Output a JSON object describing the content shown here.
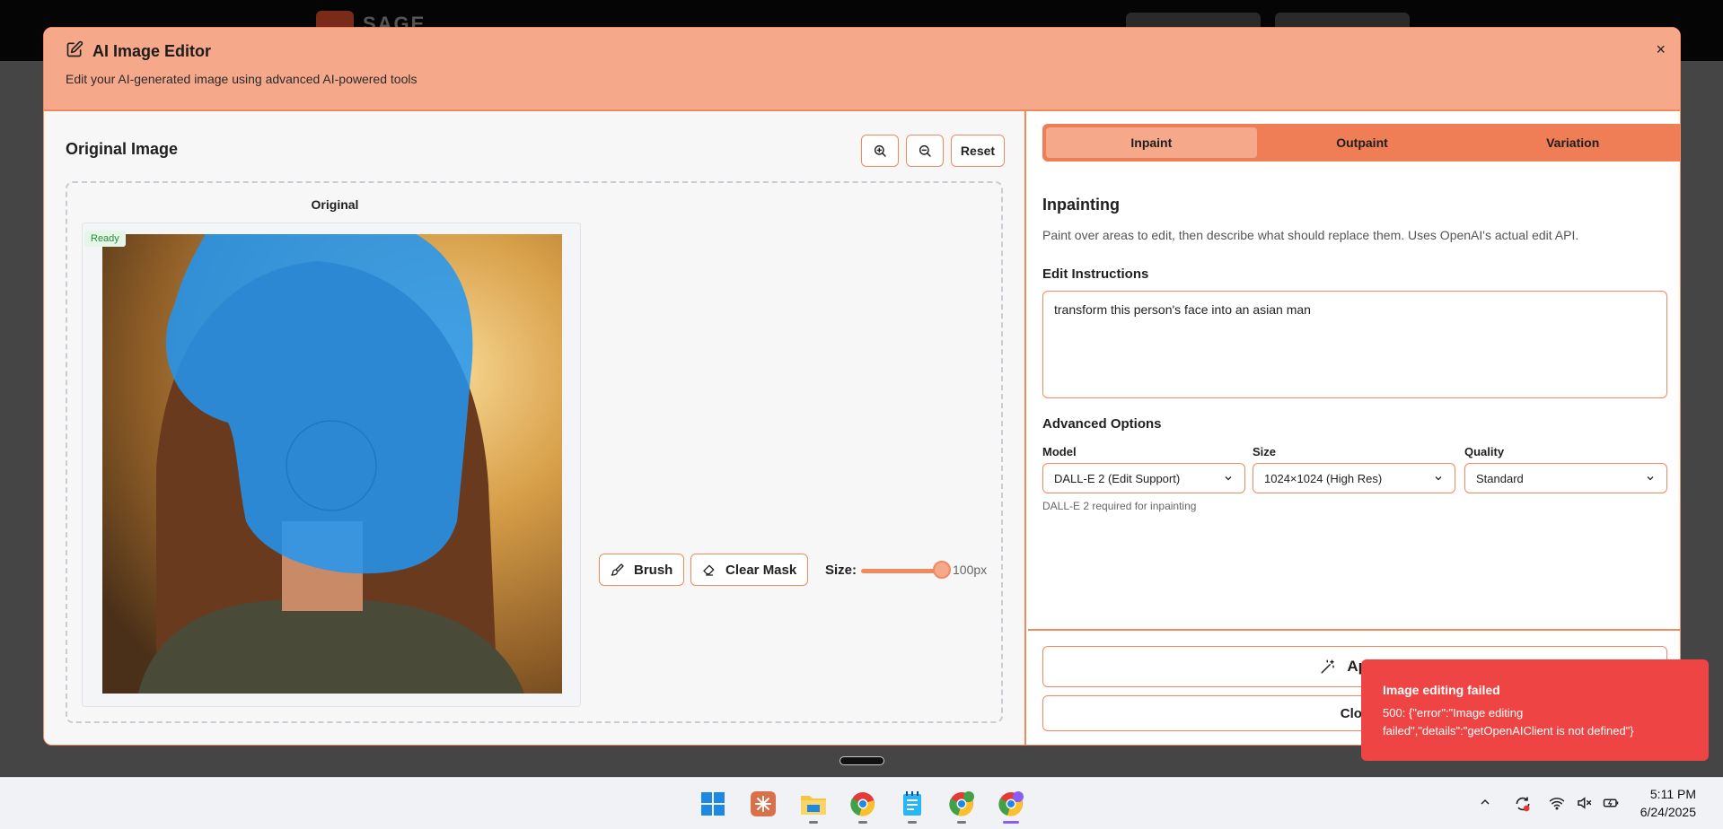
{
  "background_app": {
    "logo_text": "SAGE"
  },
  "modal": {
    "title": "AI Image Editor",
    "subtitle": "Edit your AI-generated image using advanced AI-powered tools",
    "close": "×"
  },
  "left_panel": {
    "title": "Original Image",
    "zoom_in_icon": "zoom-in-icon",
    "zoom_out_icon": "zoom-out-icon",
    "reset_label": "Reset",
    "image_label": "Original",
    "status_badge": "Ready",
    "tools": {
      "brush_label": "Brush",
      "clear_mask_label": "Clear Mask",
      "size_label": "Size:",
      "size_value": "100px",
      "size_fraction": 1.0
    }
  },
  "right_panel": {
    "tabs": [
      {
        "label": "Inpaint",
        "active": true
      },
      {
        "label": "Outpaint",
        "active": false
      },
      {
        "label": "Variation",
        "active": false
      }
    ],
    "section_title": "Inpainting",
    "section_desc": "Paint over areas to edit, then describe what should replace them. Uses OpenAI's actual edit API.",
    "instructions_label": "Edit Instructions",
    "instructions_value": "transform this person's face into an asian man",
    "advanced_label": "Advanced Options",
    "model": {
      "label": "Model",
      "value": "DALL-E 2 (Edit Support)"
    },
    "size": {
      "label": "Size",
      "value": "1024×1024 (High Res)"
    },
    "quality": {
      "label": "Quality",
      "value": "Standard"
    },
    "hint": "DALL-E 2 required for inpainting",
    "apply_label": "Apply",
    "close_label": "Clos"
  },
  "toast": {
    "title": "Image editing failed",
    "message": "500: {\"error\":\"Image editing failed\",\"details\":\"getOpenAIClient is not defined\"}"
  },
  "taskbar": {
    "time": "5:11 PM",
    "date": "6/24/2025"
  },
  "colors": {
    "accent": "#f08a5d",
    "header": "#f5a88a",
    "tab_bar": "#ef7d55",
    "mask": "#2196f3",
    "error": "#ef4444"
  }
}
